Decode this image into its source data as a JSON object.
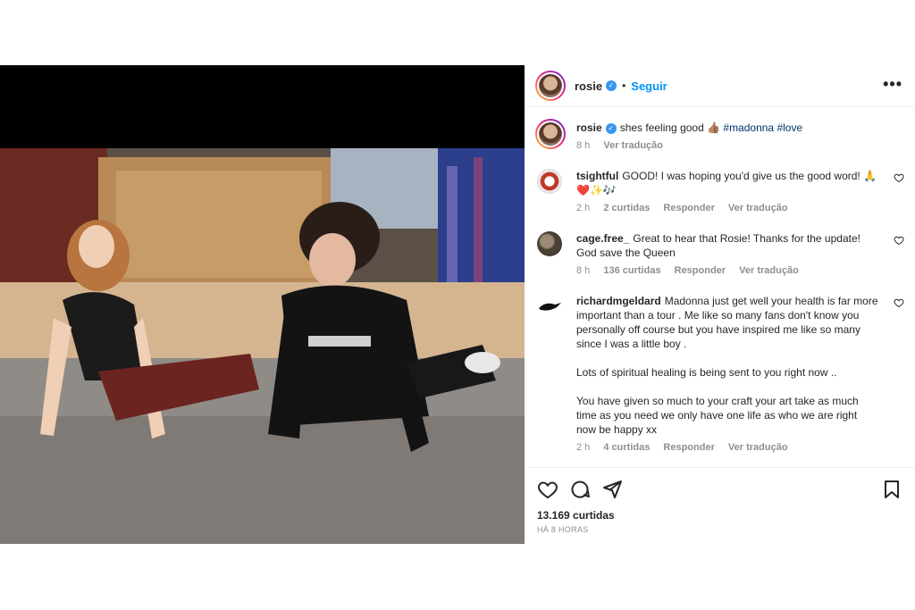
{
  "post": {
    "author": "rosie",
    "follow_label": "Seguir",
    "separator": "•",
    "more_label": "•••"
  },
  "caption": {
    "username": "rosie",
    "text": "shes feeling good 👍🏽",
    "hashtags": "#madonna #love",
    "time": "8 h",
    "translate": "Ver tradução"
  },
  "comments": [
    {
      "username": "tsightful",
      "text": "GOOD! I was hoping you'd give us the good word! 🙏❤️✨🎶",
      "time": "2 h",
      "likes": "2 curtidas",
      "reply": "Responder",
      "translate": "Ver tradução"
    },
    {
      "username": "cage.free_",
      "text": "Great to hear that Rosie! Thanks for the update! God save the Queen",
      "time": "8 h",
      "likes": "136 curtidas",
      "reply": "Responder",
      "translate": "Ver tradução"
    },
    {
      "username": "richardmgeldard",
      "text1": "Madonna just get well your health is far more important than a tour . Me like so many fans don't know you personally off course but you have inspired me like so many since I was a little boy .",
      "text2": "Lots of spiritual healing is being sent to you right now ..",
      "text3": "You have given so much to your craft your art take as much time as you need we only have one life as who we are right now be happy xx",
      "time": "2 h",
      "likes": "4 curtidas",
      "reply": "Responder",
      "translate": "Ver tradução"
    }
  ],
  "footer": {
    "likes": "13.169 curtidas",
    "ago": "HÁ 8 HORAS"
  },
  "colors": {
    "accent": "#0095f6",
    "verified": "#3897f0",
    "muted": "#8e8e8e"
  },
  "icons": [
    "more-icon",
    "heart-icon",
    "comment-icon",
    "share-icon",
    "bookmark-icon",
    "verified-icon"
  ]
}
